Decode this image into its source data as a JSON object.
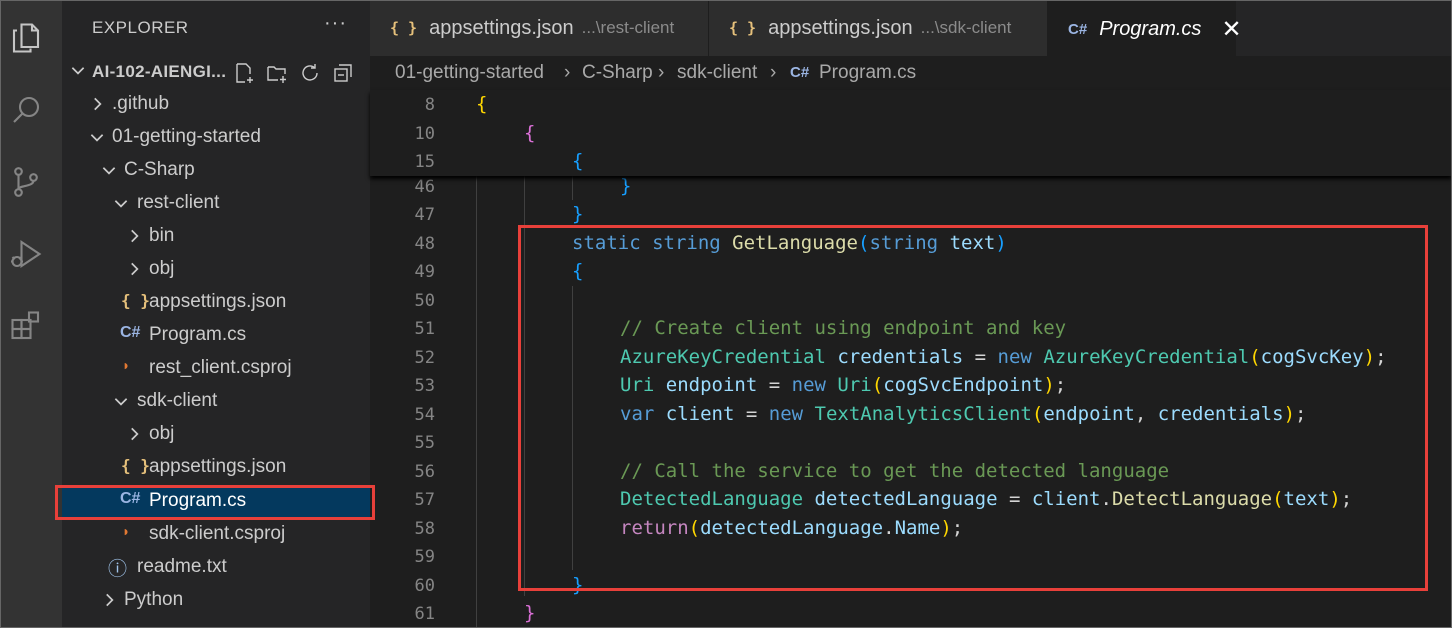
{
  "sidebar": {
    "title": "EXPLORER",
    "more": "···",
    "root": "AI-102-AIENGI...",
    "tree": [
      {
        "label": ".github",
        "type": "folder",
        "expanded": false
      },
      {
        "label": "01-getting-started",
        "type": "folder",
        "expanded": true
      },
      {
        "label": "C-Sharp",
        "type": "folder",
        "expanded": true
      },
      {
        "label": "rest-client",
        "type": "folder",
        "expanded": true
      },
      {
        "label": "bin",
        "type": "folder",
        "expanded": false
      },
      {
        "label": "obj",
        "type": "folder",
        "expanded": false
      },
      {
        "label": "appsettings.json",
        "type": "json",
        "icon": "{ }"
      },
      {
        "label": "Program.cs",
        "type": "csharp",
        "icon": "C#"
      },
      {
        "label": "rest_client.csproj",
        "type": "csproj",
        "icon": "rss"
      },
      {
        "label": "sdk-client",
        "type": "folder",
        "expanded": true
      },
      {
        "label": "obj",
        "type": "folder",
        "expanded": false
      },
      {
        "label": "appsettings.json",
        "type": "json",
        "icon": "{ }"
      },
      {
        "label": "Program.cs",
        "type": "csharp",
        "icon": "C#",
        "selected": true
      },
      {
        "label": "sdk-client.csproj",
        "type": "csproj",
        "icon": "rss"
      },
      {
        "label": "readme.txt",
        "type": "info",
        "icon": "i"
      },
      {
        "label": "Python",
        "type": "folder",
        "expanded": false
      }
    ]
  },
  "tabs": [
    {
      "label": "appsettings.json",
      "description": "...\\rest-client",
      "icon": "{ }",
      "active": false
    },
    {
      "label": "appsettings.json",
      "description": "...\\sdk-client",
      "icon": "{ }",
      "active": false
    },
    {
      "label": "Program.cs",
      "description": "",
      "icon": "C#",
      "active": true,
      "close": "✕"
    }
  ],
  "breadcrumb": [
    "01-getting-started",
    "C-Sharp",
    "sdk-client",
    "Program.cs"
  ],
  "editor": {
    "sticky_lines": [
      {
        "num": "8",
        "text": "{"
      },
      {
        "num": "10",
        "text": "{"
      },
      {
        "num": "15",
        "text": "{"
      }
    ],
    "lines": [
      {
        "num": "46",
        "text": "}"
      },
      {
        "num": "47",
        "text": "}"
      },
      {
        "num": "48",
        "text": "static string GetLanguage(string text)"
      },
      {
        "num": "49",
        "text": "{"
      },
      {
        "num": "50",
        "text": ""
      },
      {
        "num": "51",
        "text": "// Create client using endpoint and key"
      },
      {
        "num": "52",
        "text": "AzureKeyCredential credentials = new AzureKeyCredential(cogSvcKey);"
      },
      {
        "num": "53",
        "text": "Uri endpoint = new Uri(cogSvcEndpoint);"
      },
      {
        "num": "54",
        "text": "var client = new TextAnalyticsClient(endpoint, credentials);"
      },
      {
        "num": "55",
        "text": ""
      },
      {
        "num": "56",
        "text": "// Call the service to get the detected language"
      },
      {
        "num": "57",
        "text": "DetectedLanguage detectedLanguage = client.DetectLanguage(text);"
      },
      {
        "num": "58",
        "text": "return(detectedLanguage.Name);"
      },
      {
        "num": "59",
        "text": ""
      },
      {
        "num": "60",
        "text": "}"
      },
      {
        "num": "61",
        "text": "}"
      }
    ]
  },
  "colors": {
    "highlight": "#e8403a",
    "keyword": "#569cd6",
    "type": "#4ec9b0",
    "function": "#dcdcaa",
    "variable": "#9cdcfe",
    "comment": "#6a9955",
    "control": "#c586c0"
  }
}
